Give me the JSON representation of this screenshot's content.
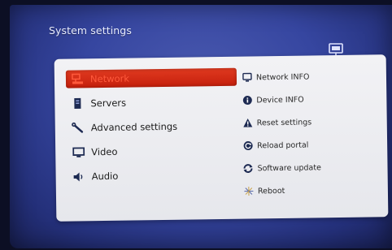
{
  "screen": {
    "title": "System settings"
  },
  "menu": {
    "items": [
      {
        "label": "Network",
        "icon": "network-icon"
      },
      {
        "label": "Servers",
        "icon": "server-icon"
      },
      {
        "label": "Advanced settings",
        "icon": "wrench-icon"
      },
      {
        "label": "Video",
        "icon": "monitor-icon"
      },
      {
        "label": "Audio",
        "icon": "speaker-icon"
      }
    ],
    "selected": "Network"
  },
  "actions": {
    "items": [
      {
        "label": "Network INFO",
        "icon": "network-info-icon"
      },
      {
        "label": "Device INFO",
        "icon": "info-icon"
      },
      {
        "label": "Reset settings",
        "icon": "warning-icon"
      },
      {
        "label": "Reload portal",
        "icon": "reload-icon"
      },
      {
        "label": "Software update",
        "icon": "sync-icon"
      },
      {
        "label": "Reboot",
        "icon": "sparkle-icon"
      }
    ]
  },
  "colors": {
    "accent": "#d0301a",
    "background": "#3646a0",
    "panel": "#eceded"
  }
}
